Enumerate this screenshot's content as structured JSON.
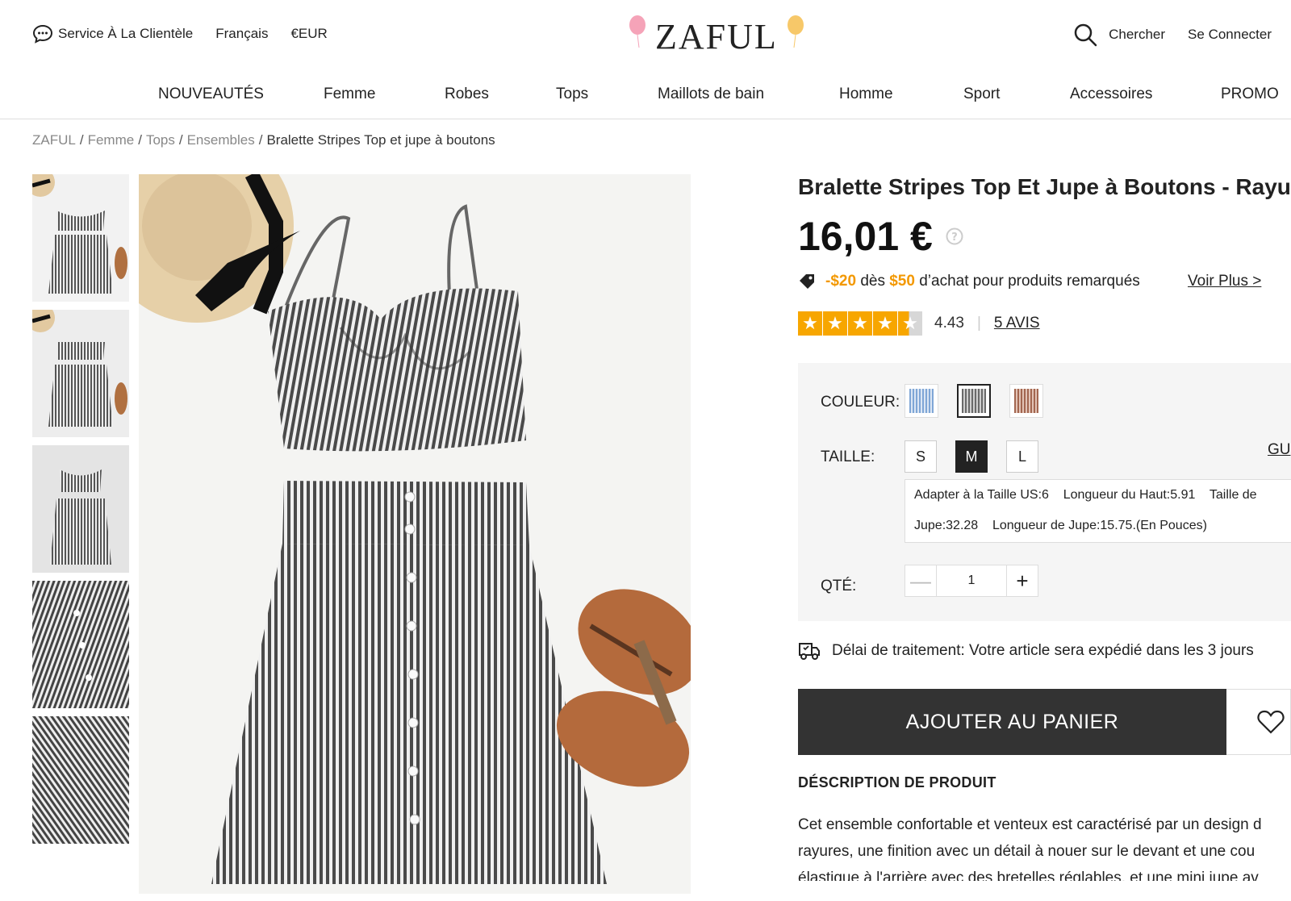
{
  "header": {
    "service_label": "Service À La Clientèle",
    "language": "Français",
    "currency": "€EUR",
    "brand": "ZAFUL",
    "search_label": "Chercher",
    "login_label": "Se Connecter"
  },
  "nav": {
    "items": [
      "NOUVEAUTÉS",
      "Femme",
      "Robes",
      "Tops",
      "Maillots de bain",
      "Homme",
      "Sport",
      "Accessoires",
      "PROMO"
    ]
  },
  "breadcrumb": {
    "items": [
      "ZAFUL",
      "Femme",
      "Tops",
      "Ensembles"
    ],
    "current": "Bralette Stripes Top et jupe à boutons"
  },
  "gallery": {
    "thumbnails": [
      "thumb-1",
      "thumb-2",
      "thumb-3",
      "thumb-4",
      "thumb-5"
    ]
  },
  "product": {
    "title": "Bralette Stripes Top Et Jupe à Boutons - Rayure",
    "price": "16,01 €",
    "promo": {
      "discount": "-$20",
      "des": "dès",
      "threshold": "$50",
      "rest": "d’achat pour produits remarqués",
      "more_link": "Voir Plus >"
    },
    "rating": {
      "value": 4.43,
      "score_text": "4.43",
      "reviews_link": "5 AVIS",
      "divider": "|"
    },
    "color_label": "COULEUR:",
    "colors": [
      {
        "name": "blue-stripe",
        "hex": "#7fa6d6",
        "selected": false
      },
      {
        "name": "gray-stripe",
        "hex": "#8a8a8a",
        "selected": true
      },
      {
        "name": "brown-stripe",
        "hex": "#a26650",
        "selected": false
      }
    ],
    "size_label": "TAILLE:",
    "sizes": [
      {
        "label": "S",
        "selected": false
      },
      {
        "label": "M",
        "selected": true
      },
      {
        "label": "L",
        "selected": false
      }
    ],
    "size_guide": "GU",
    "size_info_line1": "Adapter à la Taille US:6    Longueur du Haut:5.91    Taille de",
    "size_info_line2": "Jupe:32.28    Longueur de Jupe:15.75.(En Pouces)",
    "qty_label": "QTÉ:",
    "qty_minus": "—",
    "qty_value": "1",
    "qty_plus": "+",
    "delay_text": "Délai de traitement: Votre article sera expédié dans les 3 jours",
    "add_to_cart": "AJOUTER AU PANIER",
    "desc_heading": "DÉSCRIPTION DE PRODUIT",
    "desc_line1": "Cet ensemble confortable et venteux est caractérisé par un design d",
    "desc_line2": "rayures, une finition avec un détail à nouer sur le devant et une cou",
    "desc_line3": "élastique à l'arrière avec des bretelles réglables, et une mini jupe av"
  },
  "colors": {
    "accent_orange": "#f39800",
    "star": "#f7a600",
    "cart_button": "#333333",
    "panel_bg": "#f5f5f5"
  }
}
